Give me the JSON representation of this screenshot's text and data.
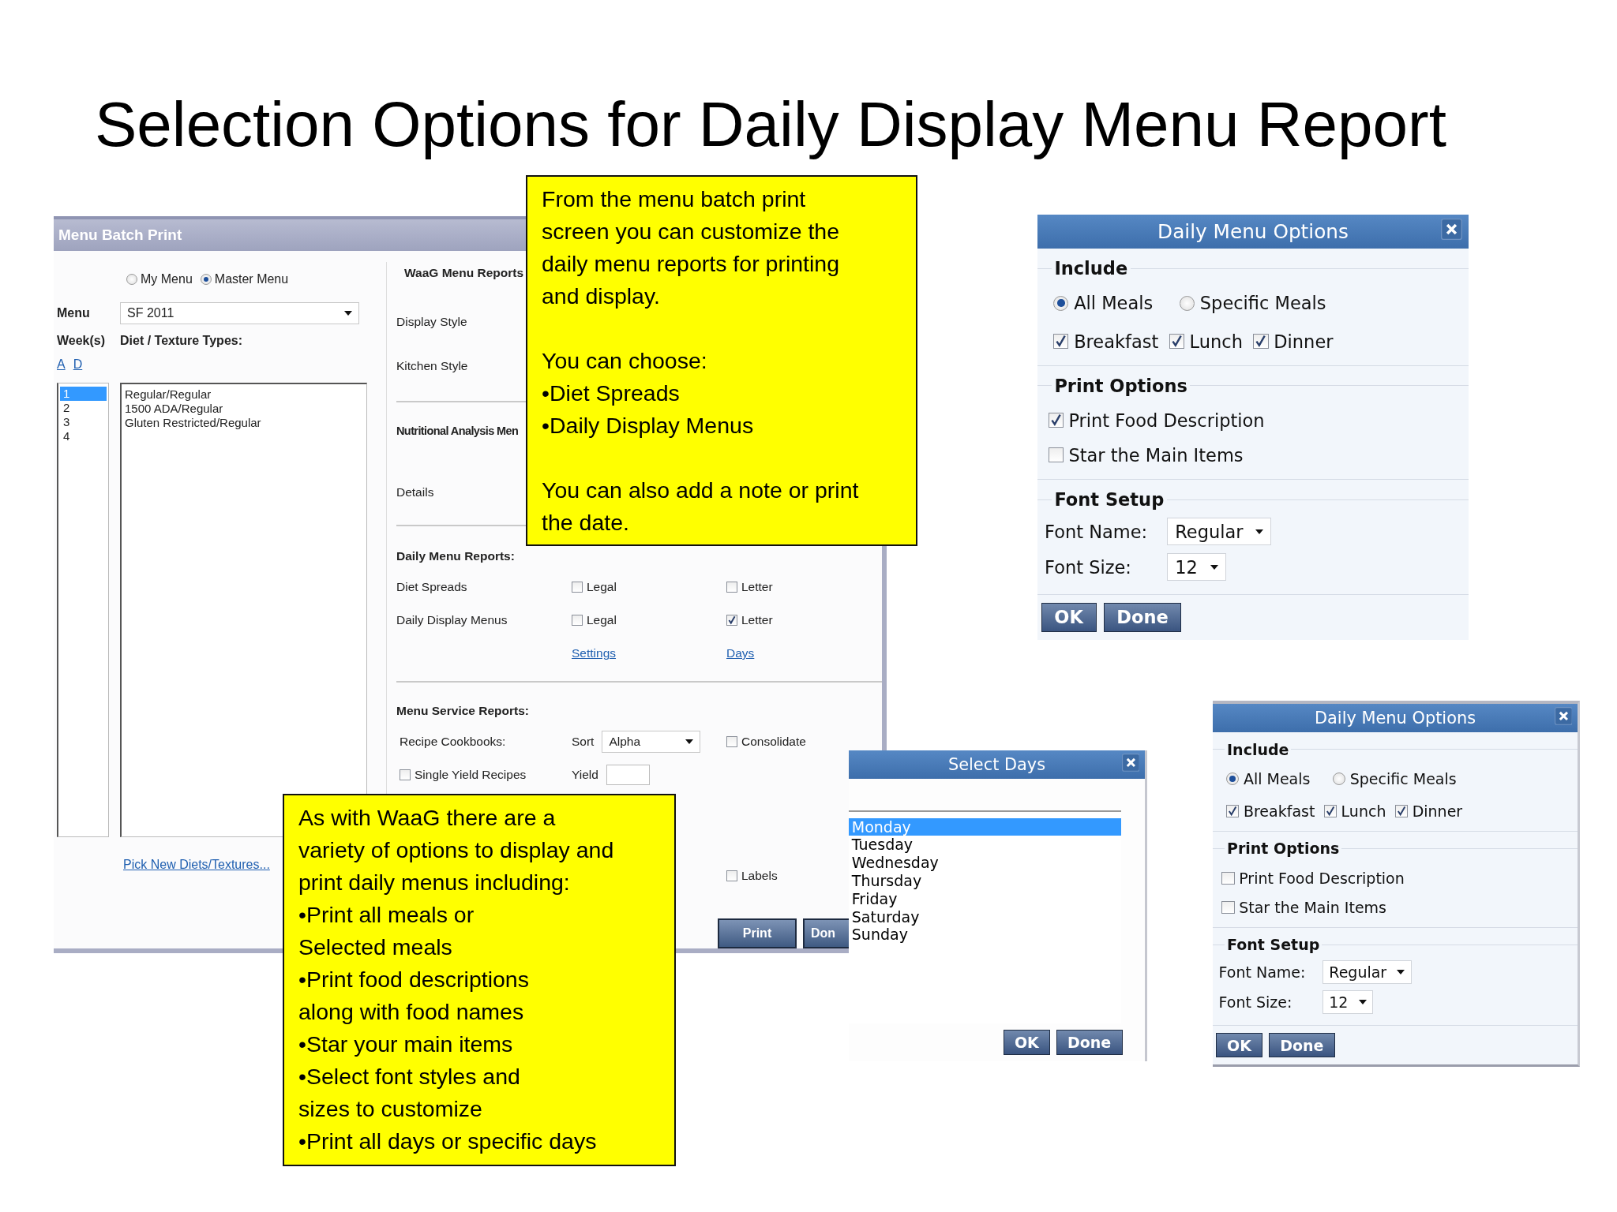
{
  "title": "Selection Options for Daily Display Menu Report",
  "batch_print": {
    "title": "Menu Batch Print",
    "menu_type": [
      {
        "label": "My Menu",
        "selected": false
      },
      {
        "label": "Master Menu",
        "selected": true
      }
    ],
    "menu_label": "Menu",
    "menu_value": "SF 2011",
    "weeks_label": "Week(s)",
    "diet_label": "Diet / Texture Types:",
    "week_links": [
      "A",
      "D"
    ],
    "weeks": [
      {
        "label": "1",
        "selected": true
      },
      {
        "label": "2",
        "selected": false
      },
      {
        "label": "3",
        "selected": false
      },
      {
        "label": "4",
        "selected": false
      }
    ],
    "diets": [
      "Regular/Regular",
      "1500 ADA/Regular",
      "Gluten Restricted/Regular"
    ],
    "pick_link": "Pick New Diets/Textures...",
    "waag_legend": "WaaG Menu Reports",
    "waag_rows": [
      "Display Style",
      "Kitchen Style"
    ],
    "nutrition_heading": "Nutritional Analysis Men",
    "nutrition_rows": [
      "Details"
    ],
    "daily_heading": "Daily Menu Reports:",
    "daily_rows": [
      {
        "label": "Diet Spreads",
        "options": [
          {
            "label": "Legal",
            "checked": false
          },
          {
            "label": "Letter",
            "checked": false
          }
        ]
      },
      {
        "label": "Daily Display Menus",
        "options": [
          {
            "label": "Legal",
            "checked": false
          },
          {
            "label": "Letter",
            "checked": true
          }
        ]
      }
    ],
    "daily_links": [
      "Settings",
      "Days"
    ],
    "service_heading": "Menu Service Reports:",
    "recipe_label": "Recipe Cookbooks:",
    "sort_label": "Sort",
    "sort_value": "Alpha",
    "consolidate": {
      "label": "Consolidate",
      "checked": false
    },
    "single_yield": {
      "label": "Single Yield Recipes",
      "checked": false
    },
    "yield_label": "Yield",
    "labels": {
      "label": "Labels",
      "checked": false
    },
    "buttons": [
      "Print",
      "Don"
    ]
  },
  "callouts": [
    {
      "groups": [
        [
          [
            "From the menu batch print",
            "screen you can customize the",
            "daily menu reports for printing",
            "and display."
          ]
        ],
        [
          [
            "You can choose:"
          ],
          [
            "•Diet Spreads"
          ],
          [
            "•Daily Display Menus"
          ]
        ],
        [
          [
            "You can also add a note or print",
            "the date."
          ]
        ]
      ]
    },
    {
      "groups": [
        [
          [
            "As with WaaG there are a",
            "variety of options to display and",
            "print daily menus including:"
          ],
          [
            "•Print all meals or",
            "Selected meals"
          ],
          [
            "•Print food descriptions",
            "along with food names"
          ],
          [
            "•Star your main items"
          ],
          [
            "•Select font styles and",
            "sizes to customize"
          ],
          [
            "•Print all days or specific days"
          ]
        ]
      ]
    }
  ],
  "daily_menu_options": [
    {
      "title": "Daily Menu Options",
      "include_legend": "Include",
      "meal_mode": [
        {
          "label": "All Meals",
          "selected": true
        },
        {
          "label": "Specific Meals",
          "selected": false
        }
      ],
      "meals": [
        {
          "label": "Breakfast",
          "checked": true
        },
        {
          "label": "Lunch",
          "checked": true
        },
        {
          "label": "Dinner",
          "checked": true
        }
      ],
      "print_legend": "Print Options",
      "print_options": [
        {
          "label": "Print Food Description",
          "checked": true
        },
        {
          "label": "Star the Main Items",
          "checked": false
        }
      ],
      "font_legend": "Font Setup",
      "font_fields": [
        {
          "label": "Font Name:",
          "value": "Regular"
        },
        {
          "label": "Font Size:",
          "value": "12"
        }
      ],
      "buttons": [
        "OK",
        "Done"
      ]
    },
    {
      "title": "Daily Menu Options",
      "include_legend": "Include",
      "meal_mode": [
        {
          "label": "All Meals",
          "selected": true
        },
        {
          "label": "Specific Meals",
          "selected": false
        }
      ],
      "meals": [
        {
          "label": "Breakfast",
          "checked": true
        },
        {
          "label": "Lunch",
          "checked": true
        },
        {
          "label": "Dinner",
          "checked": true
        }
      ],
      "print_legend": "Print Options",
      "print_options": [
        {
          "label": "Print Food Description",
          "checked": false
        },
        {
          "label": "Star the Main Items",
          "checked": false
        }
      ],
      "font_legend": "Font Setup",
      "font_fields": [
        {
          "label": "Font Name:",
          "value": "Regular"
        },
        {
          "label": "Font Size:",
          "value": "12"
        }
      ],
      "buttons": [
        "OK",
        "Done"
      ]
    }
  ],
  "select_days": {
    "title": "Select Days",
    "days": [
      {
        "label": "Monday",
        "selected": true
      },
      {
        "label": "Tuesday",
        "selected": false
      },
      {
        "label": "Wednesday",
        "selected": false
      },
      {
        "label": "Thursday",
        "selected": false
      },
      {
        "label": "Friday",
        "selected": false
      },
      {
        "label": "Saturday",
        "selected": false
      },
      {
        "label": "Sunday",
        "selected": false
      }
    ],
    "buttons": [
      "OK",
      "Done"
    ]
  }
}
